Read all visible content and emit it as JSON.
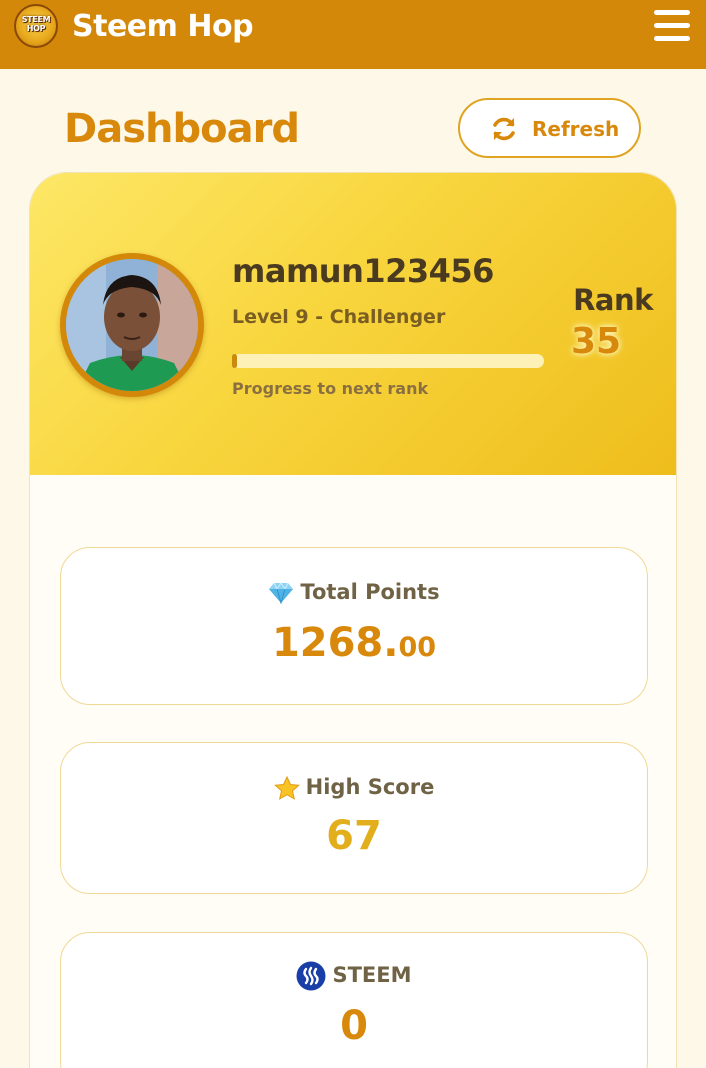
{
  "app": {
    "logo_text": "STEEM HOP",
    "title": "Steem Hop",
    "menu_icon": "hamburger-menu-icon"
  },
  "page": {
    "title": "Dashboard",
    "refresh_label": "Refresh",
    "refresh_icon": "refresh-icon"
  },
  "profile": {
    "username": "mamun123456",
    "level_text": "Level 9 - Challenger",
    "progress_label": "Progress to next rank",
    "progress_fraction": 0.015,
    "rank_label": "Rank",
    "rank_value": "35"
  },
  "stats": [
    {
      "icon": "gem-icon",
      "title": "Total Points",
      "value_main": "1268.",
      "value_decimal": "00"
    },
    {
      "icon": "star-icon",
      "title": "High Score",
      "value_main": "67",
      "value_decimal": ""
    },
    {
      "icon": "steem-logo-icon",
      "title": "STEEM",
      "value_main": "0",
      "value_decimal": ""
    }
  ],
  "colors": {
    "header_bg": "#d4880a",
    "accent": "#d8890c",
    "high_score": "#e3ae1c",
    "page_bg": "#fdf8e8",
    "card_border": "#f0d897"
  }
}
